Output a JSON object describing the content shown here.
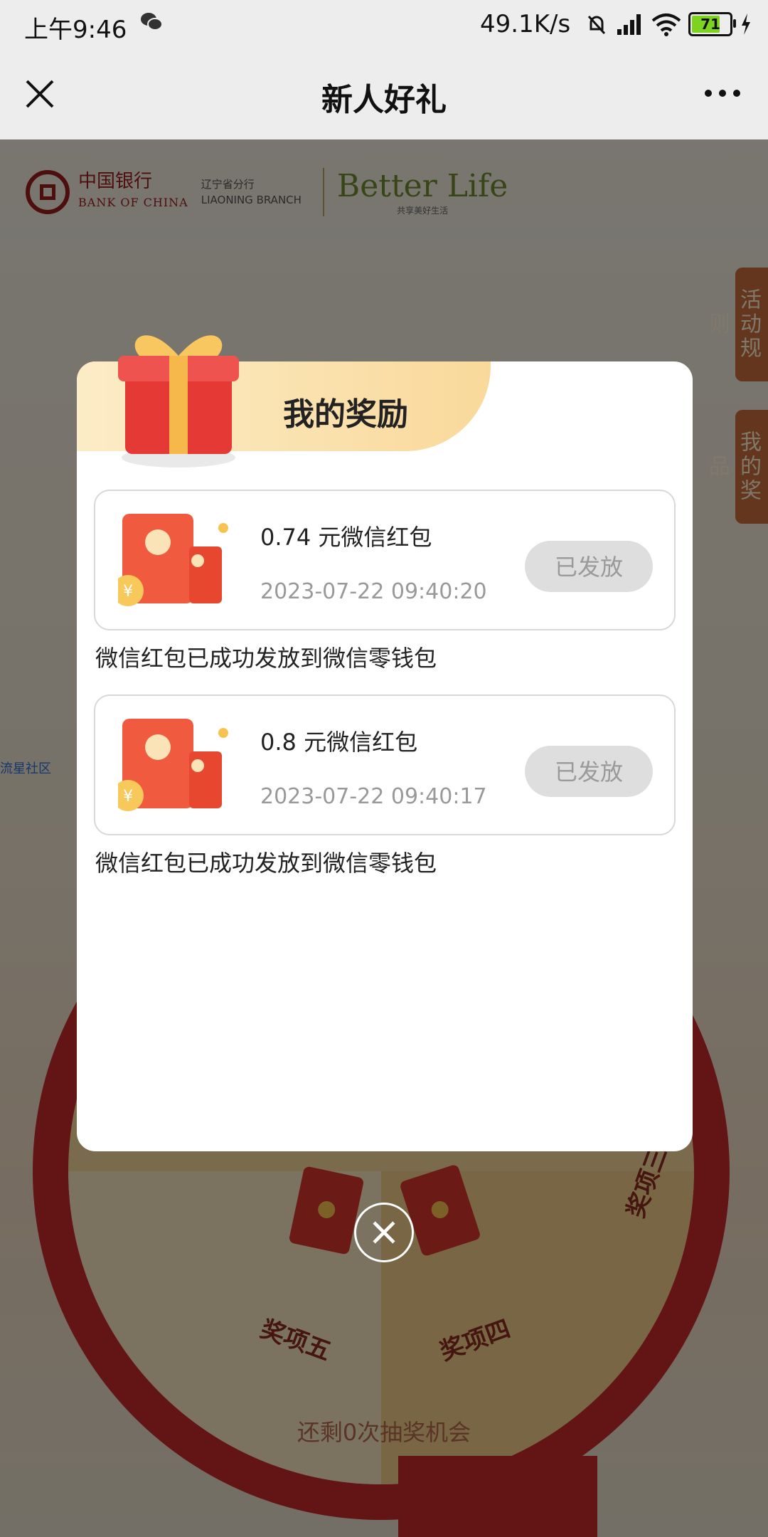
{
  "status_bar": {
    "time": "上午9:46",
    "network_rate": "49.1K/s",
    "battery": "71"
  },
  "title_bar": {
    "title": "新人好礼"
  },
  "background": {
    "bank_name_cn": "中国银行",
    "bank_name_en": "BANK OF CHINA",
    "branch_cn": "辽宁省分行",
    "branch_en": "LIAONING BRANCH",
    "slogan": "Better Life",
    "slogan_sub": "共享美好生活",
    "tabs": [
      "活动规则",
      "我的奖品"
    ],
    "side_link": "流星社区",
    "wheel_labels": [
      "奖项五",
      "奖项四",
      "奖项三"
    ],
    "remaining": "还剩0次抽奖机会"
  },
  "modal": {
    "title": "我的奖励",
    "rewards": [
      {
        "name": "0.74 元微信红包",
        "time": "2023-07-22 09:40:20",
        "status": "已发放",
        "note": "微信红包已成功发放到微信零钱包"
      },
      {
        "name": "0.8 元微信红包",
        "time": "2023-07-22 09:40:17",
        "status": "已发放",
        "note": "微信红包已成功发放到微信零钱包"
      }
    ]
  },
  "colors": {
    "accent_red": "#c62828",
    "header_gold": "#f9d99b",
    "button_disabled": "#dedede"
  }
}
